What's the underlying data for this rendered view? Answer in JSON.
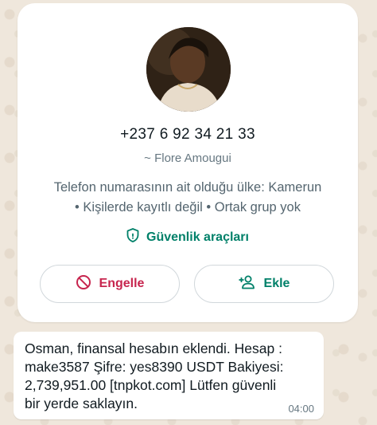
{
  "contact": {
    "phone": "+237 6 92 34 21 33",
    "push_name": "~ Flore Amougui",
    "country_line": "Telefon numarasının ait olduğu ülke: Kamerun",
    "meta_line": "• Kişilerde kayıtlı değil • Ortak grup yok",
    "security_label": "Güvenlik araçları",
    "security_icon": "shield-icon",
    "block_label": "Engelle",
    "block_icon": "block-icon",
    "add_label": "Ekle",
    "add_icon": "add-person-icon"
  },
  "message": {
    "text": "Osman, finansal hesabın eklendi. Hesap :\nmake3587 Şifre: yes8390 USDT Bakiyesi:\n2,739,951.00  [tnpkot.com] Lütfen güvenli\nbir yerde saklayın.",
    "time": "04:00"
  },
  "colors": {
    "accent": "#008069",
    "danger": "#c7254e",
    "chat_background": "#efeae2"
  }
}
